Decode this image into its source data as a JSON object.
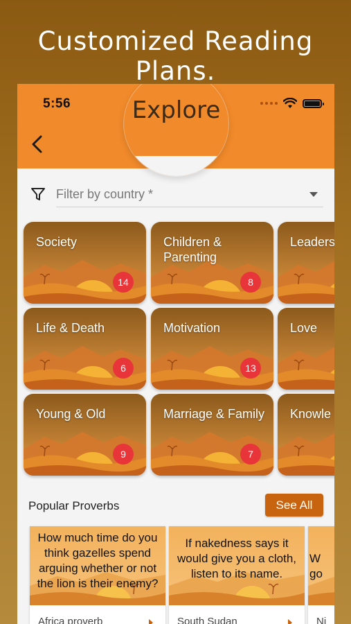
{
  "promo": {
    "headline": "Customized Reading Plans."
  },
  "status_bar": {
    "time": "5:56"
  },
  "header": {
    "title": "Explore",
    "back_icon": "chevron-left-icon"
  },
  "filter": {
    "placeholder": "Filter by country *",
    "icon": "filter-icon"
  },
  "categories": [
    {
      "label": "Society",
      "count": "14"
    },
    {
      "label": "Children & Parenting",
      "count": "8"
    },
    {
      "label": "Leaders",
      "count": ""
    },
    {
      "label": "Life & Death",
      "count": "6"
    },
    {
      "label": "Motivation",
      "count": "13"
    },
    {
      "label": "Love",
      "count": ""
    },
    {
      "label": "Young & Old",
      "count": "9"
    },
    {
      "label": "Marriage & Family",
      "count": "7"
    },
    {
      "label": "Knowle",
      "count": ""
    }
  ],
  "popular": {
    "title": "Popular Proverbs",
    "see_all_label": "See All",
    "items": [
      {
        "quote": "How much time do you think gazelles spend arguing whether or not the lion is their enemy?",
        "origin": "Africa proverb"
      },
      {
        "quote": "If nakedness says it would give you a cloth, listen to its name.",
        "origin": "South Sudan"
      },
      {
        "quote": "W go",
        "origin": "Ni"
      }
    ]
  },
  "colors": {
    "app_bar": "#f18a2a",
    "badge": "#e8353a",
    "button": "#c8640f",
    "background_top": "#8b5a12"
  }
}
